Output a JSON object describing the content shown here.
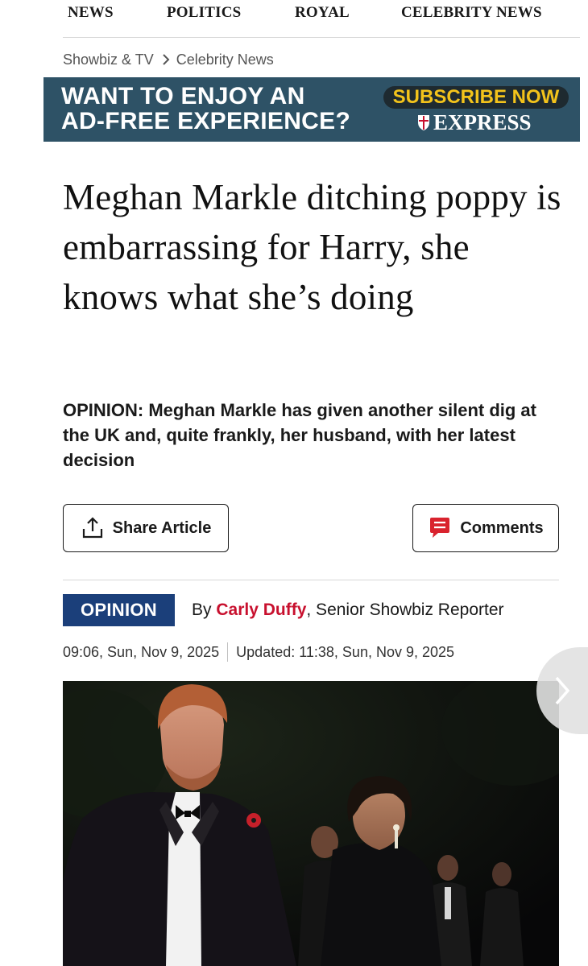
{
  "nav": {
    "items": [
      "NEWS",
      "POLITICS",
      "ROYAL",
      "CELEBRITY NEWS"
    ]
  },
  "breadcrumb": {
    "items": [
      "Showbiz & TV",
      "Celebrity News"
    ]
  },
  "ad": {
    "line1": "WANT TO ENJOY AN",
    "line2": "AD-FREE EXPERIENCE?",
    "cta": "SUBSCRIBE NOW",
    "brand": "EXPRESS"
  },
  "article": {
    "headline": "Meghan Markle ditching poppy is embarrassing for Harry, she knows what she’s doing",
    "standfirst": "OPINION: Meghan Markle has given another silent dig at the UK and, quite frankly, her husband, with her latest decision",
    "share_label": "Share Article",
    "comments_label": "Comments",
    "tag": "OPINION",
    "by": "By",
    "author": "Carly Duffy",
    "author_role": ", Senior Showbiz Reporter",
    "published": "09:06, Sun, Nov 9, 2025",
    "updated": "Updated: 11:38, Sun, Nov 9, 2025"
  },
  "colors": {
    "ad_background": "#2e5266",
    "ad_cta": "#f3c31b",
    "opinion_tag": "#1b3f7a",
    "author": "#c8102e",
    "comments_icon": "#d9232e"
  },
  "icons": {
    "breadcrumb_separator": "chevron-right-icon",
    "share": "share-upload-icon",
    "comments": "comment-bubble-icon",
    "gallery_next": "chevron-right-icon"
  }
}
